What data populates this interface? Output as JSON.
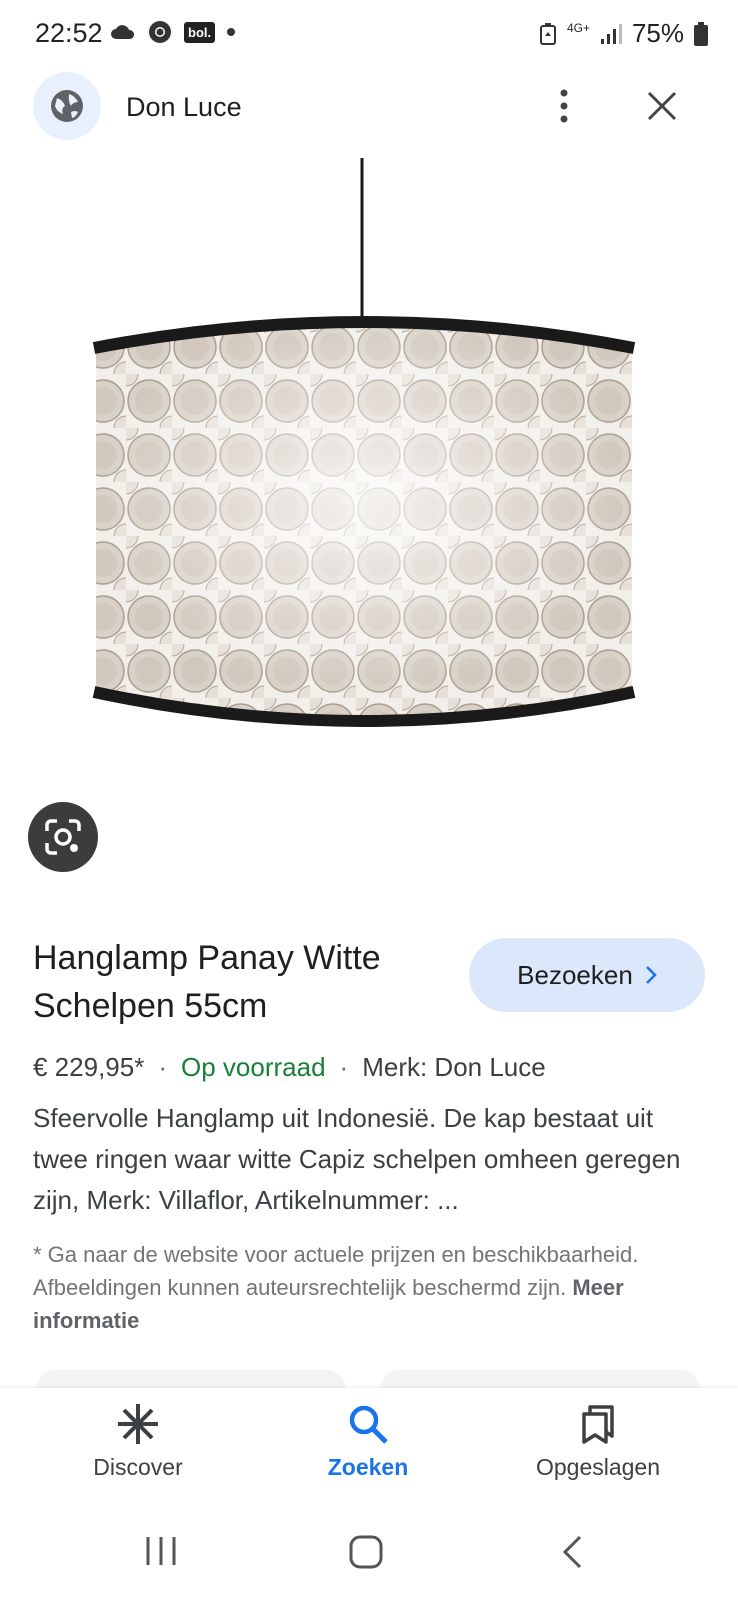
{
  "status_bar": {
    "time": "22:52",
    "left_icons": [
      "cloud-icon",
      "chrome-icon",
      "bol-icon",
      "dot-icon"
    ],
    "bol_label": "bol.",
    "network": "4G+",
    "battery": "75%"
  },
  "header": {
    "site_name": "Don Luce",
    "icons": [
      "globe-icon",
      "more-vert-icon",
      "close-icon"
    ]
  },
  "product": {
    "title": "Hanglamp Panay Witte Schelpen 55cm",
    "visit_label": "Bezoeken",
    "price": "€ 229,95*",
    "stock": "Op voorraad",
    "brand": "Merk: Don Luce",
    "description": "Sfeervolle Hanglamp uit Indonesië. De kap bestaat uit twee ringen waar witte Capiz schelpen omheen geregen zijn, Merk: Villaflor, Artikelnummer: ...",
    "disclaimer": "* Ga naar de website voor actuele prijzen en beschikbaarheid. Afbeeldingen kunnen auteursrechtelijk beschermd zijn.",
    "more_info": "Meer informatie"
  },
  "bottom_nav": {
    "items": [
      {
        "label": "Discover",
        "icon": "asterisk-icon",
        "active": false
      },
      {
        "label": "Zoeken",
        "icon": "search-icon",
        "active": true
      },
      {
        "label": "Opgeslagen",
        "icon": "bookmarks-icon",
        "active": false
      }
    ]
  },
  "colors": {
    "accent": "#1a73e8",
    "stock_green": "#188038",
    "visit_button_bg": "#dbe7fb",
    "lamp_frame": "#1a1a1a"
  }
}
